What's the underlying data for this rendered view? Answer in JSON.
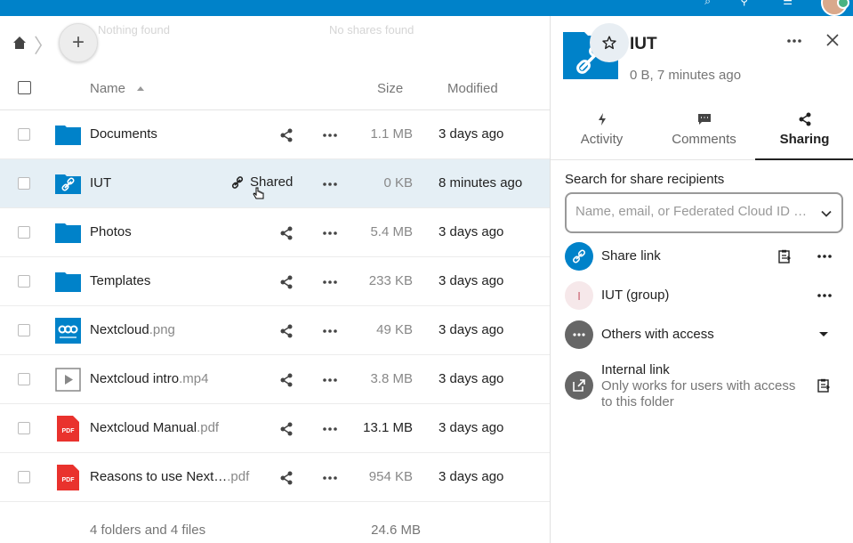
{
  "colors": {
    "accent": "#0082c9",
    "folder": "#0082c9",
    "pdf": "#e9322d",
    "active_row": "#e5eff5"
  },
  "breadcrumb": {
    "home_icon": "home-icon",
    "ghost_left": "Nothing found",
    "ghost_right": "No shares found"
  },
  "table": {
    "headers": {
      "name": "Name",
      "size": "Size",
      "modified": "Modified"
    },
    "rows": [
      {
        "name": "Documents",
        "ext": "",
        "type": "folder",
        "size": "1.1 MB",
        "modified": "3 days ago"
      },
      {
        "name": "IUT",
        "ext": "",
        "type": "folder-link",
        "size": "0 KB",
        "modified": "8 minutes ago",
        "shared_label": "Shared"
      },
      {
        "name": "Photos",
        "ext": "",
        "type": "folder",
        "size": "5.4 MB",
        "modified": "3 days ago"
      },
      {
        "name": "Templates",
        "ext": "",
        "type": "folder",
        "size": "233 KB",
        "modified": "3 days ago"
      },
      {
        "name": "Nextcloud",
        "ext": ".png",
        "type": "image",
        "size": "49 KB",
        "modified": "3 days ago"
      },
      {
        "name": "Nextcloud intro",
        "ext": ".mp4",
        "type": "video",
        "size": "3.8 MB",
        "modified": "3 days ago"
      },
      {
        "name": "Nextcloud Manual",
        "ext": ".pdf",
        "type": "pdf",
        "size": "13.1 MB",
        "modified": "3 days ago"
      },
      {
        "name": "Reasons to use Next…",
        "ext": ".pdf",
        "type": "pdf",
        "size": "954 KB",
        "modified": "3 days ago"
      }
    ],
    "summary": {
      "label": "4 folders and 4 files",
      "size": "24.6 MB"
    }
  },
  "sidebar": {
    "title": "IUT",
    "subtitle": "0 B, 7 minutes ago",
    "tabs": [
      {
        "label": "Activity",
        "icon": "activity-icon"
      },
      {
        "label": "Comments",
        "icon": "comment-icon"
      },
      {
        "label": "Sharing",
        "icon": "share-icon"
      }
    ],
    "search": {
      "label": "Search for share recipients",
      "placeholder": "Name, email, or Federated Cloud ID …"
    },
    "shares": {
      "link": "Share link",
      "group": "IUT (group)",
      "group_initial": "I",
      "others": "Others with access",
      "internal": "Internal link",
      "internal_desc": "Only works for users with access to this folder"
    }
  }
}
